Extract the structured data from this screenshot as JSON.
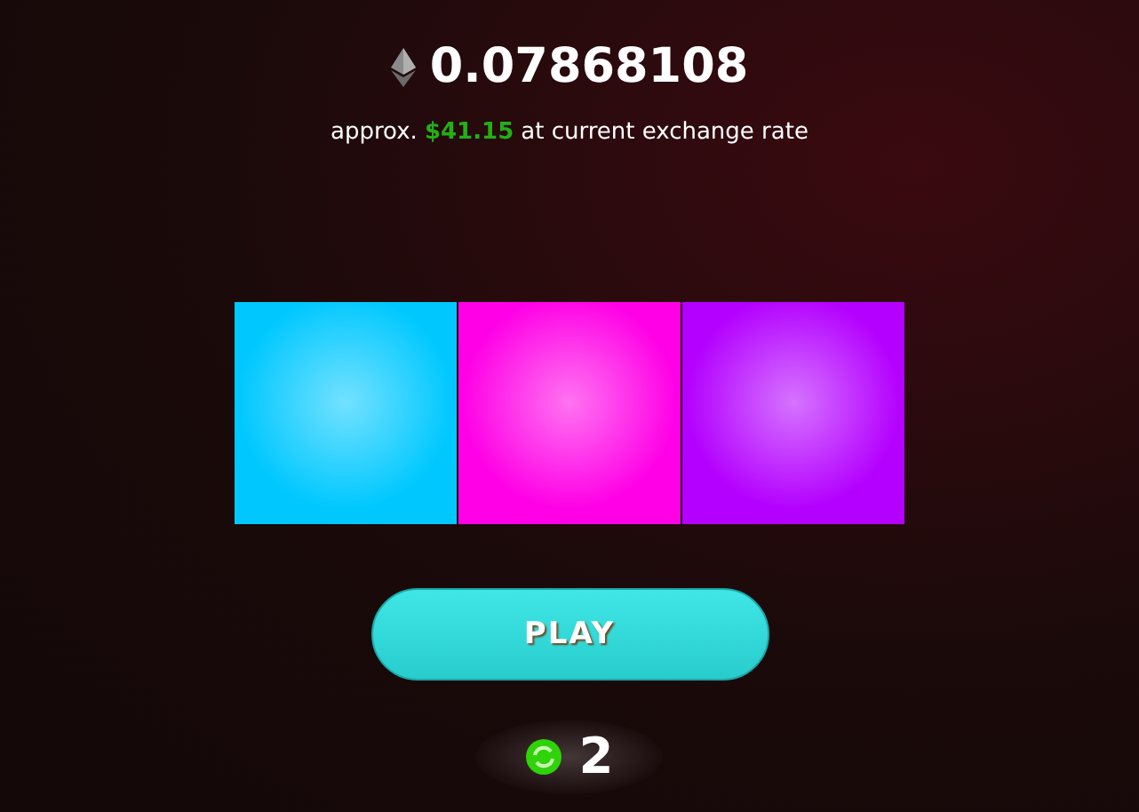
{
  "amount": "0.07868108",
  "approx": {
    "prefix": "approx.",
    "price": "$41.15",
    "suffix": "at current exchange rate"
  },
  "tiles": [
    {
      "color": "#00c8ff"
    },
    {
      "color": "#ff00e6"
    },
    {
      "color": "#b400ff"
    }
  ],
  "play_button": "PLAY",
  "spins": "2"
}
